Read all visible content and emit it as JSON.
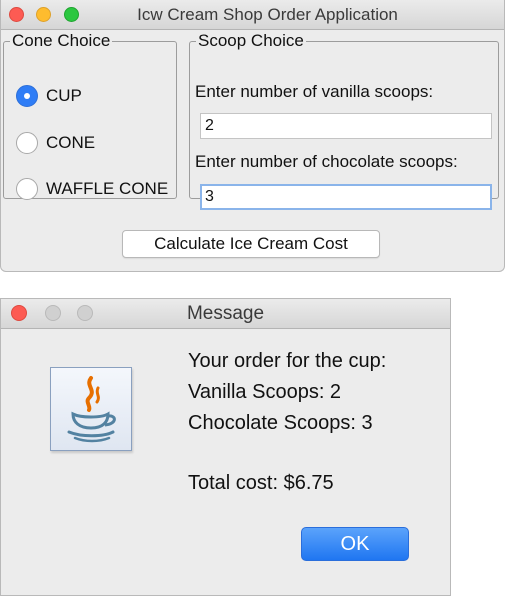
{
  "app": {
    "title": "Icw Cream Shop Order Application"
  },
  "cone_choice": {
    "legend": "Cone Choice",
    "options": [
      {
        "label": "CUP",
        "selected": true
      },
      {
        "label": "CONE",
        "selected": false
      },
      {
        "label": "WAFFLE CONE",
        "selected": false
      }
    ]
  },
  "scoop_choice": {
    "legend": "Scoop Choice",
    "vanilla_label": "Enter number of vanilla scoops:",
    "vanilla_value": "2",
    "chocolate_label": "Enter number of chocolate scoops:",
    "chocolate_value": "3"
  },
  "calculate_button": "Calculate Ice Cream Cost",
  "dialog": {
    "title": "Message",
    "lines": [
      "Your order for the cup:",
      "Vanilla Scoops: 2",
      "Chocolate Scoops: 3",
      "Total cost: $6.75"
    ],
    "ok_label": "OK",
    "icon": "java-coffee-cup-icon"
  },
  "colors": {
    "accent": "#2f7df6",
    "close": "#fd5b53",
    "minimize": "#febc2e",
    "maximize": "#2bc740"
  }
}
